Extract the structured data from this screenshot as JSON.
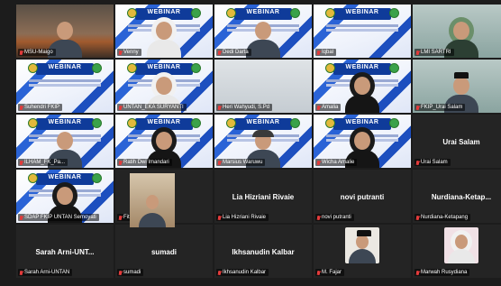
{
  "meeting": {
    "participants": [
      {
        "name": "MSU-Maigo",
        "variant": "room",
        "avatar": "person"
      },
      {
        "name": "Venny",
        "variant": "webinar",
        "avatar": "hijab-white"
      },
      {
        "name": "Dedi Darta",
        "variant": "webinar",
        "avatar": "person"
      },
      {
        "name": "Iqbal",
        "variant": "webinar",
        "avatar": "none"
      },
      {
        "name": "LMI SARTRI",
        "variant": "teal",
        "avatar": "hijab-green"
      },
      {
        "name": "Suhendri FKIP",
        "variant": "webinar",
        "avatar": "none"
      },
      {
        "name": "UNTAN_EKA SURYANTI",
        "variant": "webinar",
        "avatar": "hijab-white"
      },
      {
        "name": "Heri Wahyudi, S.Pd",
        "variant": "light",
        "avatar": "none"
      },
      {
        "name": "Amalia",
        "variant": "webinar",
        "avatar": "hijab-black"
      },
      {
        "name": "FKIP_Urai Salam",
        "variant": "teal",
        "avatar": "peci"
      },
      {
        "name": "ILHAM_FK_Pa...",
        "variant": "webinar",
        "avatar": "person"
      },
      {
        "name": "Ratih Dwi Imandari",
        "variant": "webinar",
        "avatar": "hijab-black"
      },
      {
        "name": "Marsius Waruwu",
        "variant": "webinar",
        "avatar": "cap"
      },
      {
        "name": "Wicha Amalie",
        "variant": "webinar",
        "avatar": "hijab-black"
      },
      {
        "name": "Urai Salam",
        "variant": "blank",
        "avatar": "none",
        "big": "Urai Salam"
      },
      {
        "name": "SDAP FKIP UNTAN Semoyati",
        "variant": "webinar",
        "avatar": "hijab-black"
      },
      {
        "name": "Fitri Sulistyaningrum",
        "variant": "blank",
        "avatar": "none"
      },
      {
        "name": "Lia Hizriani Rivaie",
        "variant": "blank",
        "avatar": "none",
        "big": "Lia Hizriani Rivaie"
      },
      {
        "name": "novi putranti",
        "variant": "blank",
        "avatar": "none",
        "big": "novi putranti"
      },
      {
        "name": "Nurdiana-Ketapang",
        "variant": "blank",
        "avatar": "none",
        "big": "Nurdiana-Ketap..."
      },
      {
        "name": "Sarah Arni-UNTAN",
        "variant": "blank",
        "avatar": "none",
        "big": "Sarah Arni-UNT..."
      },
      {
        "name": "sumadi",
        "variant": "blank",
        "avatar": "none",
        "big": "sumadi"
      },
      {
        "name": "Ikhsanudin Kalbar",
        "variant": "blank",
        "avatar": "none",
        "big": "Ikhsanudin Kalbar"
      },
      {
        "name": "M. Fajar",
        "variant": "blank",
        "avatar": "thumb-peci"
      },
      {
        "name": "Marwah Rusydiana",
        "variant": "blank",
        "avatar": "thumb-hijab"
      }
    ],
    "banner_text": "WEBINAR",
    "mic_icon": "muted-mic-icon"
  }
}
